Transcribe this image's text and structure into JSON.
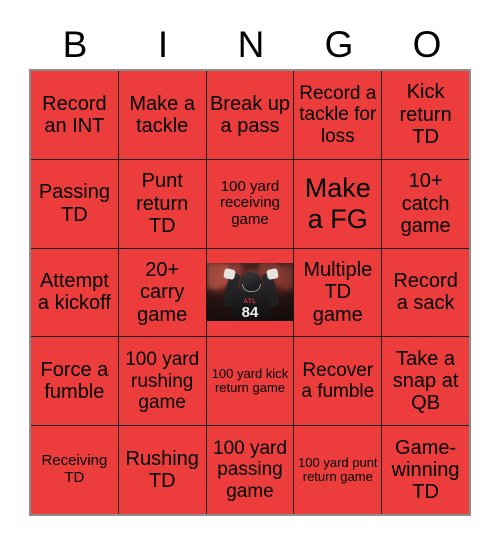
{
  "header": {
    "letters": [
      "B",
      "I",
      "N",
      "G",
      "O"
    ]
  },
  "grid": {
    "columns": 5,
    "rows": 5,
    "cell_color": "#ec3c3c",
    "border_color": "#1a1a1a",
    "frame_color": "#8c8c8c",
    "text_color": "#000000",
    "cells": [
      {
        "text": "Record an INT",
        "size": "lg"
      },
      {
        "text": "Make a tackle",
        "size": "lg"
      },
      {
        "text": "Break up a pass",
        "size": "lg"
      },
      {
        "text": "Record a tackle for loss",
        "size": "md"
      },
      {
        "text": "Kick return TD",
        "size": "lg"
      },
      {
        "text": "Passing TD",
        "size": "lg"
      },
      {
        "text": "Punt return TD",
        "size": "lg"
      },
      {
        "text": "100 yard receiving game",
        "size": "sm"
      },
      {
        "text": "Make a FG",
        "size": "xl"
      },
      {
        "text": "10+ catch game",
        "size": "lg"
      },
      {
        "text": "Attempt a kickoff",
        "size": "lg"
      },
      {
        "text": "20+ carry game",
        "size": "lg"
      },
      {
        "text": "",
        "size": "lg",
        "type": "image"
      },
      {
        "text": "Multiple TD game",
        "size": "lg"
      },
      {
        "text": "Record a sack",
        "size": "lg"
      },
      {
        "text": "Force a fumble",
        "size": "lg"
      },
      {
        "text": "100 yard rushing game",
        "size": "md"
      },
      {
        "text": "100 yard kick return game",
        "size": "xs"
      },
      {
        "text": "Recover a fumble",
        "size": "md"
      },
      {
        "text": "Take a snap at QB",
        "size": "lg"
      },
      {
        "text": "Receiving TD",
        "size": "sm"
      },
      {
        "text": "Rushing TD",
        "size": "lg"
      },
      {
        "text": "100 yard passing game",
        "size": "md"
      },
      {
        "text": "100 yard punt return game",
        "size": "xs"
      },
      {
        "text": "Game-winning TD",
        "size": "lg"
      }
    ]
  },
  "center_image": {
    "description": "football-player-celebrating",
    "team_abbreviation": "ATL",
    "jersey_number": "84"
  }
}
